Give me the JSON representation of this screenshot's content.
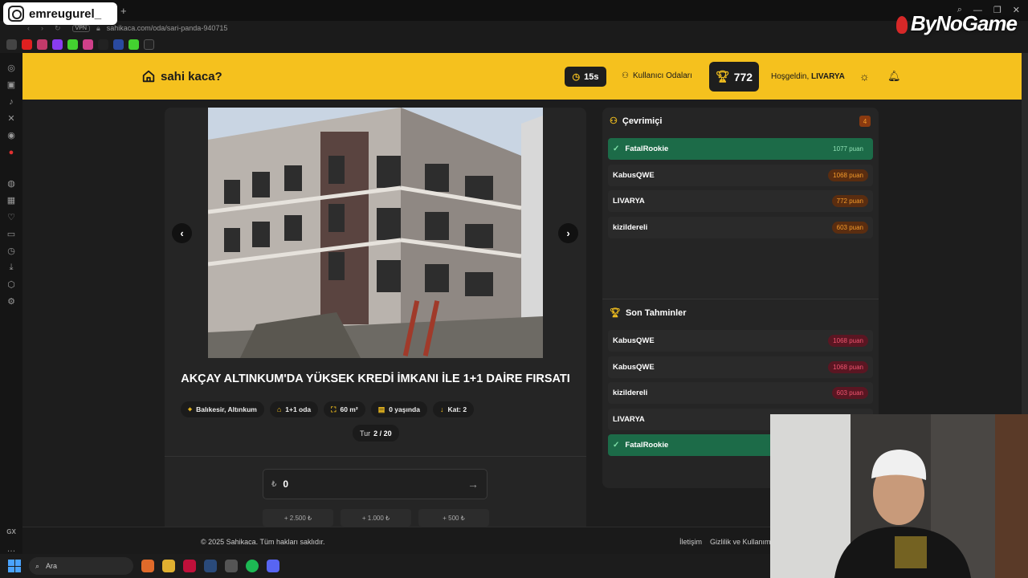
{
  "overlay": {
    "instagram_handle": "emreugurel_",
    "sponsor_logo": "ByNoGame"
  },
  "browser": {
    "url": "sahikaca.com/oda/sari-panda-940715",
    "vpn_label": "VPN",
    "new_tab": "+"
  },
  "header": {
    "brand": "sahi kaca?",
    "timer": "15s",
    "rooms_link": "Kullanıcı Odaları",
    "score": "772",
    "welcome_prefix": "Hoşgeldin,",
    "username": "LIVARYA"
  },
  "listing": {
    "title": "AKÇAY ALTINKUM'DA YÜKSEK KREDİ İMKANI İLE 1+1 DAİRE FIRSATI",
    "chips": [
      {
        "icon": "map-pin-icon",
        "label": "Balıkesir, Altınkum"
      },
      {
        "icon": "home-icon",
        "label": "1+1 oda"
      },
      {
        "icon": "expand-icon",
        "label": "60 m²"
      },
      {
        "icon": "building-icon",
        "label": "0 yaşında"
      },
      {
        "icon": "arrow-down-icon",
        "label": "Kat: 2"
      }
    ],
    "round_label": "Tur",
    "round_value": "2 / 20"
  },
  "guess": {
    "currency": "₺",
    "value": "0",
    "increments": [
      "+ 2.500 ₺",
      "+ 1.000 ₺",
      "+ 500 ₺"
    ]
  },
  "online": {
    "title": "Çevrimiçi",
    "count": "4",
    "players": [
      {
        "name": "FatalRookie",
        "points": "1077 puan",
        "active": true
      },
      {
        "name": "KabusQWE",
        "points": "1068 puan",
        "active": false
      },
      {
        "name": "LIVARYA",
        "points": "772 puan",
        "active": false
      },
      {
        "name": "kizildereli",
        "points": "603 puan",
        "active": false
      }
    ]
  },
  "predictions": {
    "title": "Son Tahminler",
    "entries": [
      {
        "name": "KabusQWE",
        "points": "1068 puan",
        "active": false
      },
      {
        "name": "KabusQWE",
        "points": "1068 puan",
        "active": false
      },
      {
        "name": "kizildereli",
        "points": "603 puan",
        "active": false
      },
      {
        "name": "LIVARYA",
        "points": "",
        "active": false
      },
      {
        "name": "FatalRookie",
        "points": "",
        "active": true
      }
    ]
  },
  "footer": {
    "copyright": "© 2025 Sahikaca. Tüm hakları saklıdır.",
    "links": [
      "İletişim",
      "Gizlilik ve Kullanım"
    ]
  },
  "taskbar": {
    "search_label": "Ara"
  },
  "sidebar": {
    "gx_label": "GX"
  },
  "colors": {
    "accent": "#f5c11e",
    "active_row": "#1c6b48",
    "panel": "#252525"
  }
}
